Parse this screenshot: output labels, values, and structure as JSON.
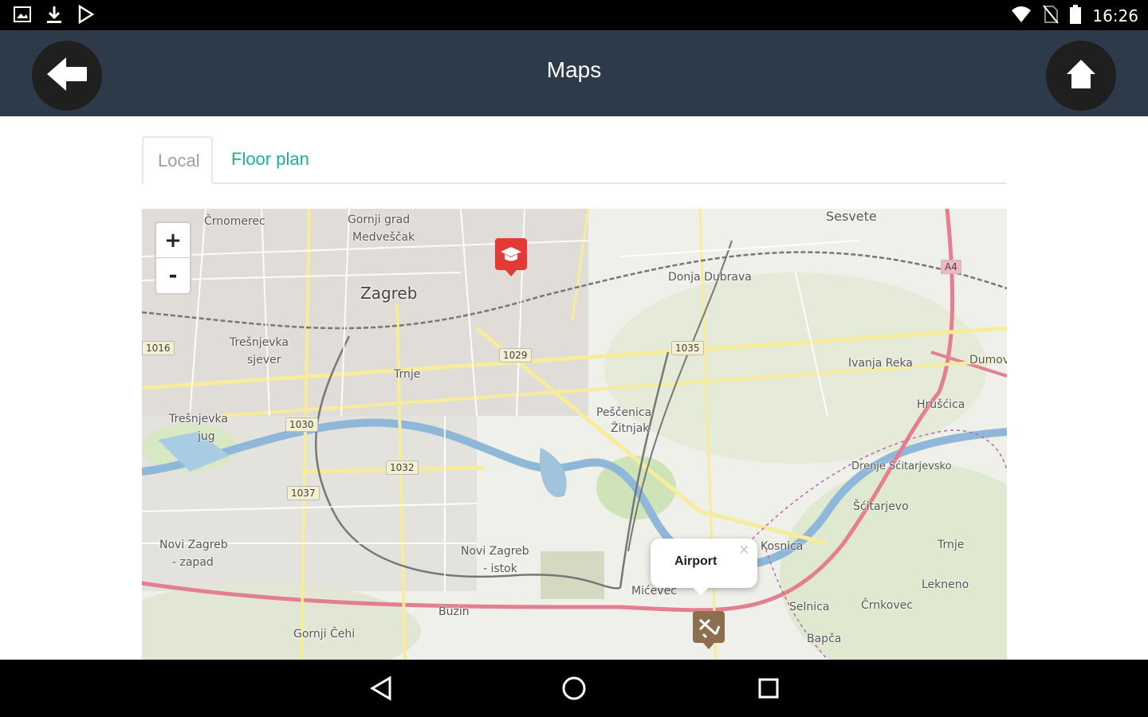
{
  "status_bar": {
    "time": "16:26",
    "left_icons": [
      "image-icon",
      "download-icon",
      "play-store-icon"
    ],
    "right_icons": [
      "wifi-icon",
      "no-sim-icon",
      "battery-icon"
    ]
  },
  "app_bar": {
    "title": "Maps",
    "back_icon": "arrow-left-icon",
    "home_icon": "home-icon",
    "color": "#2d3a4a"
  },
  "tabs": [
    {
      "label": "Local",
      "active": true
    },
    {
      "label": "Floor plan",
      "active": false
    }
  ],
  "map": {
    "zoom_in": "+",
    "zoom_out": "-",
    "popup": {
      "text": "Airport",
      "close": "×"
    },
    "markers": [
      {
        "name": "university-marker",
        "color": "#e53935"
      },
      {
        "name": "airport-marker",
        "color": "#8d6e4f"
      }
    ],
    "places": [
      "Črnomerec",
      "Gornji grad",
      "Medveščak",
      "Zagreb",
      "Sesvete",
      "Donja Dubrava",
      "Trešnjevka",
      "sjever",
      "Trnje",
      "Ivanja Reka",
      "Dumov",
      "Hrušćica",
      "Trešnjevka",
      "jug",
      "Peščenica",
      "Žitnjak",
      "Drenje Šćitarjevsko",
      "Šćitarjevo",
      "Novi Zagreb",
      "- zapad",
      "Novi Zagreb",
      "- istok",
      "Kosnica",
      "Trnje",
      "Mićevec",
      "Lekneno",
      "Selnica",
      "Črnkovec",
      "Buzin",
      "Gornji Čehi",
      "Bapča"
    ],
    "road_numbers": [
      "1016",
      "1029",
      "1035",
      "1030",
      "1032",
      "1037",
      "A4"
    ]
  },
  "nav_bar": {
    "back_icon": "nav-back-icon",
    "home_icon": "nav-home-icon",
    "recents_icon": "nav-recents-icon"
  }
}
